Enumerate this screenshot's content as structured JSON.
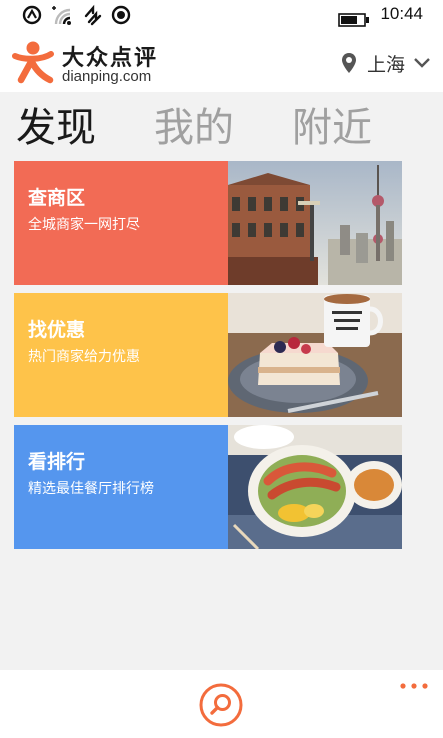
{
  "status_bar": {
    "time": "10:44",
    "icons": [
      "nfc-icon",
      "signal-icon",
      "data-icon",
      "location-dot-icon",
      "battery-icon"
    ]
  },
  "header": {
    "brand_name": "大众点评",
    "brand_url": "dianping.com",
    "city": "上海",
    "accent_color": "#f36c3d"
  },
  "tabs": [
    {
      "label": "发现",
      "active": true
    },
    {
      "label": "我的",
      "active": false
    },
    {
      "label": "附近",
      "active": false
    }
  ],
  "cards": [
    {
      "title": "查商区",
      "subtitle": "全城商家一网打尽",
      "color": "#f26b55",
      "image": "shanghai-skyline-photo"
    },
    {
      "title": "找优惠",
      "subtitle": "热门商家给力优惠",
      "color": "#fec34a",
      "image": "cake-and-coffee-photo"
    },
    {
      "title": "看排行",
      "subtitle": "精选最佳餐厅排行榜",
      "color": "#5596ee",
      "image": "food-bowl-photo"
    }
  ],
  "app_bar": {
    "search_icon": "search-icon",
    "more_icon": "more-dots-icon"
  }
}
